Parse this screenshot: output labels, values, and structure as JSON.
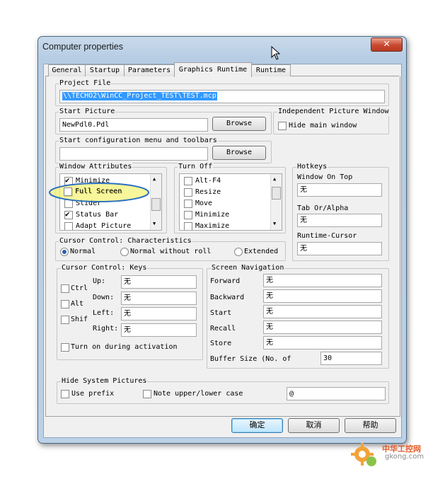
{
  "window": {
    "title": "Computer properties",
    "close_glyph": "✕"
  },
  "tabs": [
    "General",
    "Startup",
    "Parameters",
    "Graphics Runtime",
    "Runtime"
  ],
  "project_file": {
    "label": "Project File",
    "value": "\\\\TECHO2\\WinCC_Project_TEST\\TEST.mcp"
  },
  "start_picture": {
    "label": "Start Picture",
    "value": "NewPdl0.Pdl",
    "browse": "Browse"
  },
  "independent": {
    "label": "Independent Picture Window",
    "hide_main": "Hide main window"
  },
  "config_menu": {
    "label": "Start configuration menu and toolbars",
    "value": "",
    "browse": "Browse"
  },
  "window_attributes": {
    "label": "Window Attributes",
    "items": [
      {
        "label": "Minimize",
        "checked": true
      },
      {
        "label": "Full Screen",
        "checked": false
      },
      {
        "label": "Slider",
        "checked": false
      },
      {
        "label": "Status Bar",
        "checked": true
      },
      {
        "label": "Adapt Picture",
        "checked": false
      }
    ]
  },
  "turn_off": {
    "label": "Turn Off",
    "items": [
      {
        "label": "Alt-F4",
        "checked": false
      },
      {
        "label": "Resize",
        "checked": false
      },
      {
        "label": "Move",
        "checked": false
      },
      {
        "label": "Minimize",
        "checked": false
      },
      {
        "label": "Maximize",
        "checked": false
      }
    ]
  },
  "hotkeys": {
    "label": "Hotkeys",
    "window_on_top": {
      "label": "Window On Top",
      "value": "无"
    },
    "tab_alpha": {
      "label": "Tab Or/Alpha",
      "value": "无"
    },
    "runtime_cursor": {
      "label": "Runtime-Cursor",
      "value": "无"
    }
  },
  "cursor_control": {
    "label": "Cursor Control: Characteristics",
    "options": [
      "Normal",
      "Normal without roll",
      "Extended"
    ],
    "selected": "Normal"
  },
  "cursor_keys": {
    "label": "Cursor Control: Keys",
    "modifiers": [
      "Ctrl",
      "Alt",
      "Shif"
    ],
    "keys": [
      {
        "label": "Up:",
        "value": "无"
      },
      {
        "label": "Down:",
        "value": "无"
      },
      {
        "label": "Left:",
        "value": "无"
      },
      {
        "label": "Right:",
        "value": "无"
      }
    ],
    "turn_on": "Turn on during activation"
  },
  "screen_navigation": {
    "label": "Screen Navigation",
    "items": [
      {
        "label": "Forward",
        "value": "无"
      },
      {
        "label": "Backward",
        "value": "无"
      },
      {
        "label": "Start",
        "value": "无"
      },
      {
        "label": "Recall",
        "value": "无"
      },
      {
        "label": "Store",
        "value": "无"
      }
    ],
    "buffer_label": "Buffer Size (No. of",
    "buffer_value": "30"
  },
  "hide_system_pictures": {
    "label": "Hide System Pictures",
    "use_prefix": "Use prefix",
    "note_case": "Note upper/lower case",
    "prefix_value": "@"
  },
  "buttons": {
    "ok": "确定",
    "cancel": "取消",
    "help": "帮助"
  },
  "watermark": {
    "line1": "中华工控网",
    "line2": "gkong.com"
  },
  "colors": {
    "highlight_ellipse": "#f4f37a",
    "selection": "#3399ff",
    "close_red": "#c9492f"
  }
}
